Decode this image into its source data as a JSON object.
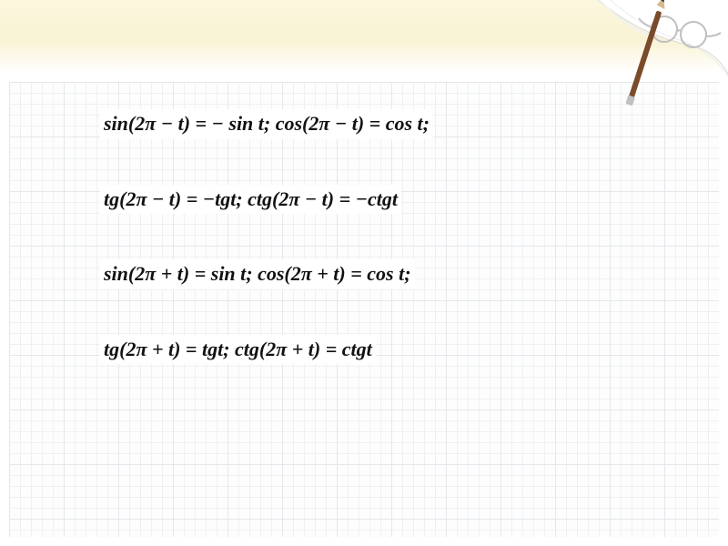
{
  "decor": {
    "corner_desc": "notebook-corner-with-pencil-and-glasses"
  },
  "formulas": {
    "line1": "sin(2π − t) = − sin t;  cos(2π − t) = cos t;",
    "line2": "tg(2π − t) = −tgt; ctg(2π − t) = −ctgt",
    "line3": "sin(2π + t) = sin t;  cos(2π + t) = cos t;",
    "line4": "tg(2π + t) = tgt; ctg(2π + t) = ctgt"
  }
}
